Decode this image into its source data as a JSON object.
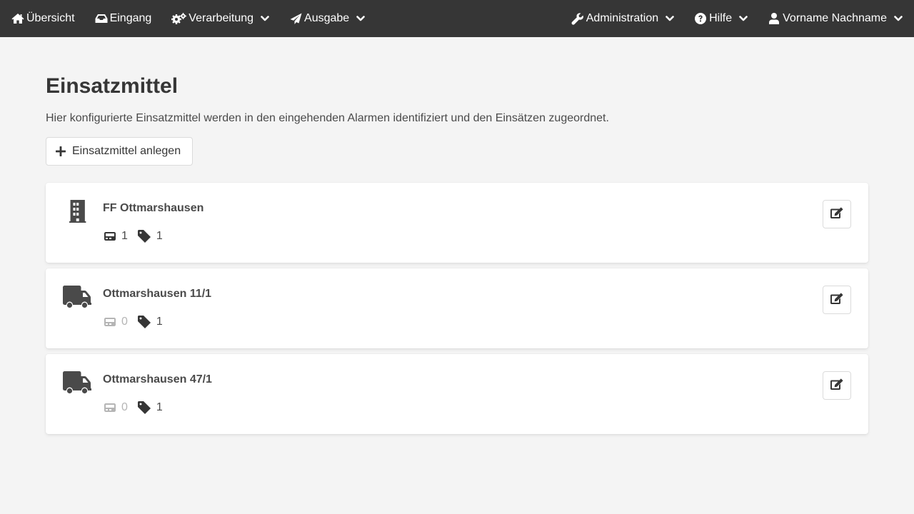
{
  "nav": {
    "left": [
      {
        "label": "Übersicht",
        "icon": "home-icon",
        "dropdown": false
      },
      {
        "label": "Eingang",
        "icon": "inbox-icon",
        "dropdown": false
      },
      {
        "label": "Verarbeitung",
        "icon": "cogs-icon",
        "dropdown": true
      },
      {
        "label": "Ausgabe",
        "icon": "paper-plane-icon",
        "dropdown": true
      }
    ],
    "right": [
      {
        "label": "Administration",
        "icon": "wrench-icon",
        "dropdown": true
      },
      {
        "label": "Hilfe",
        "icon": "question-circle-icon",
        "dropdown": true
      },
      {
        "label": "Vorname Nachname",
        "icon": "user-icon",
        "dropdown": true
      }
    ]
  },
  "page": {
    "title": "Einsatzmittel",
    "description": "Hier konfigurierte Einsatzmittel werden in den eingehenden Alarmen identifiziert und den Einsätzen zugeordnet.",
    "add_button_label": "Einsatzmittel anlegen"
  },
  "units": [
    {
      "name": "FF Ottmarshausen",
      "icon": "building-icon",
      "pager_count": "1",
      "tag_count": "1"
    },
    {
      "name": "Ottmarshausen 11/1",
      "icon": "truck-icon",
      "pager_count": "0",
      "tag_count": "1"
    },
    {
      "name": "Ottmarshausen 47/1",
      "icon": "truck-icon",
      "pager_count": "0",
      "tag_count": "1"
    }
  ],
  "colors": {
    "navbar": "#363636",
    "background": "#f4f4f4",
    "text": "#363636",
    "muted": "#b5b5b5"
  }
}
